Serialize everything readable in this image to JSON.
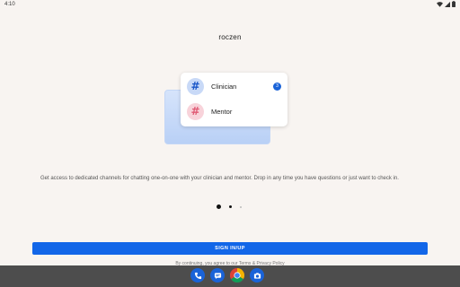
{
  "status_bar": {
    "time": "4:10"
  },
  "app": {
    "title": "roczen"
  },
  "illustration": {
    "channels": [
      {
        "label": "Clinician",
        "icon": "hashtag-icon",
        "color": "#1a56c8",
        "badge": "3"
      },
      {
        "label": "Mentor",
        "icon": "hashtag-icon",
        "color": "#e05a74"
      }
    ]
  },
  "onboarding": {
    "description": "Get access to dedicated channels for chatting one-on-one with your clinician and mentor. Drop in any time you have questions or just want to check in.",
    "pages_total": 3,
    "current_page": 1
  },
  "actions": {
    "signin_label": "SIGN IN/UP",
    "terms_text": "By continuing, you agree to our Terms & Privacy Policy"
  },
  "taskbar": {
    "apps": [
      "phone-icon",
      "messages-icon",
      "chrome-icon",
      "camera-icon"
    ]
  },
  "colors": {
    "background": "#f8f4f1",
    "accent": "#1266e8",
    "taskbar": "#4d4d4d"
  }
}
